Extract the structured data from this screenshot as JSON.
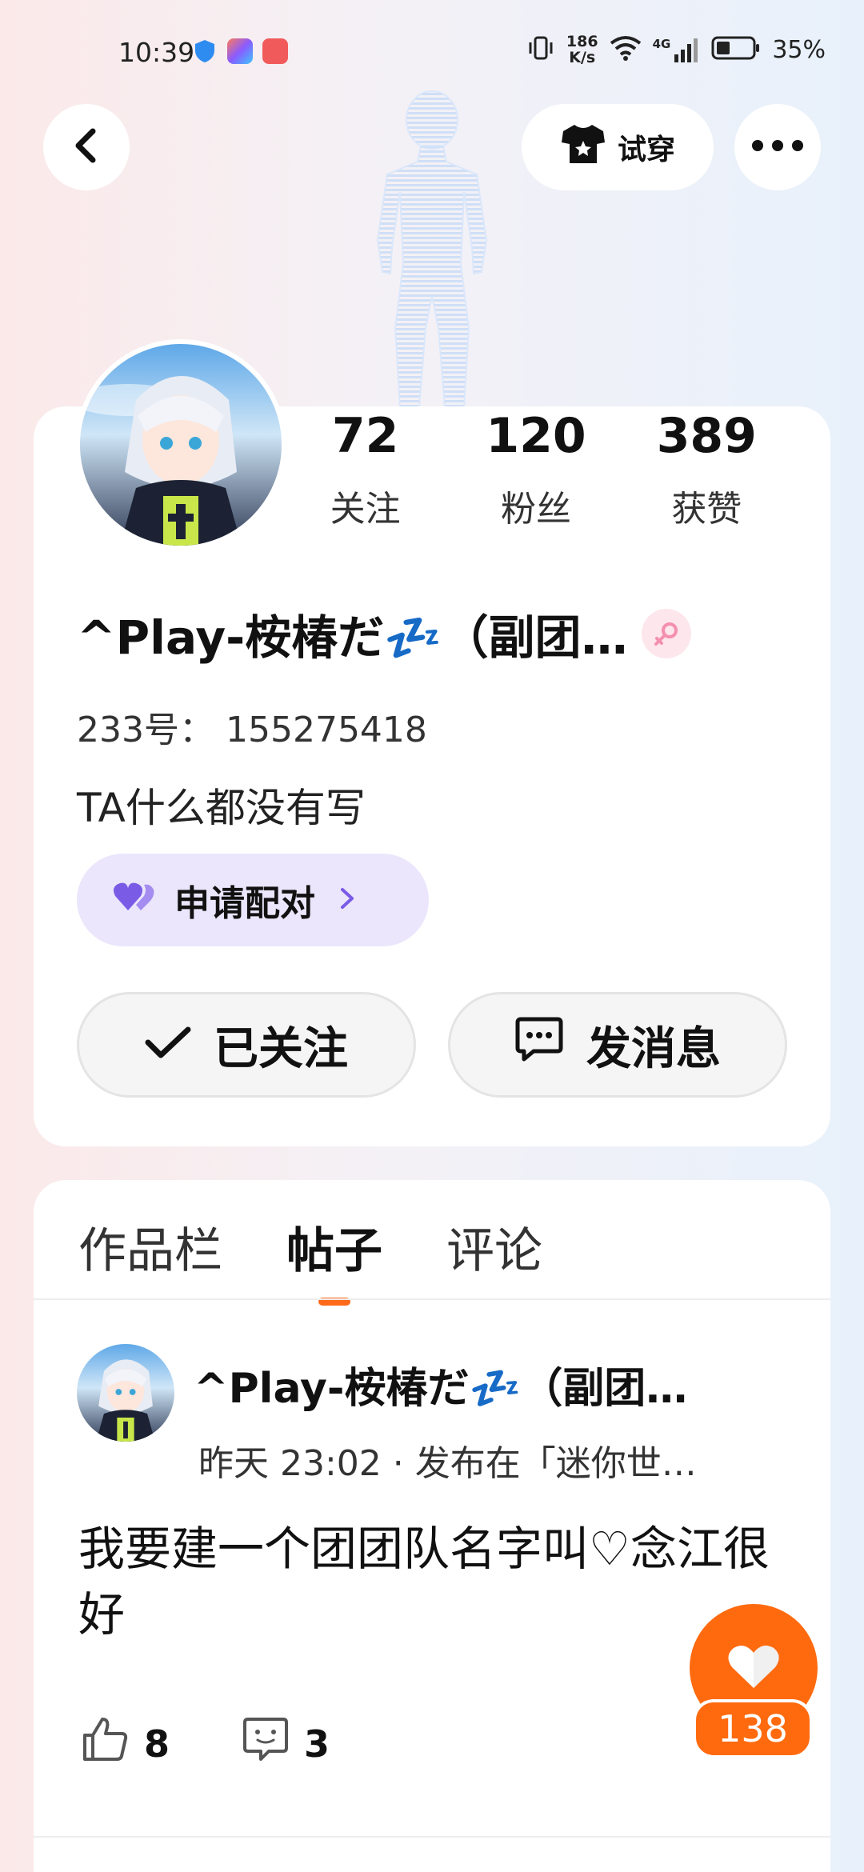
{
  "status_bar": {
    "time": "10:39",
    "net_speed_value": "186",
    "net_speed_unit": "K/s",
    "network_type": "4G",
    "battery_percent": "35%"
  },
  "header": {
    "try_on_label": "试穿"
  },
  "profile": {
    "stats": [
      {
        "value": "72",
        "label": "关注"
      },
      {
        "value": "120",
        "label": "粉丝"
      },
      {
        "value": "389",
        "label": "获赞"
      }
    ],
    "username": "^Play-桉椿だ💤（副团…",
    "uid": "233号： 155275418",
    "bio": "TA什么都没有写",
    "pair_button_label": "申请配对",
    "follow_button_label": "已关注",
    "message_button_label": "发消息"
  },
  "tabs": [
    {
      "label": "作品栏",
      "active": false
    },
    {
      "label": "帖子",
      "active": true
    },
    {
      "label": "评论",
      "active": false
    }
  ],
  "post": {
    "author": "^Play-桉椿だ💤（副团…",
    "meta": "昨天 23:02 · 发布在「迷你世…",
    "body": "我要建一个团团队名字叫♡念江很好",
    "likes": "8",
    "comments": "3"
  },
  "floating_like": {
    "count": "138"
  },
  "colors": {
    "accent": "#ff6a0f",
    "pair_bg": "#ebe6fb",
    "pair_icon": "#7a5be6",
    "gender_badge": "#f48fb1"
  }
}
